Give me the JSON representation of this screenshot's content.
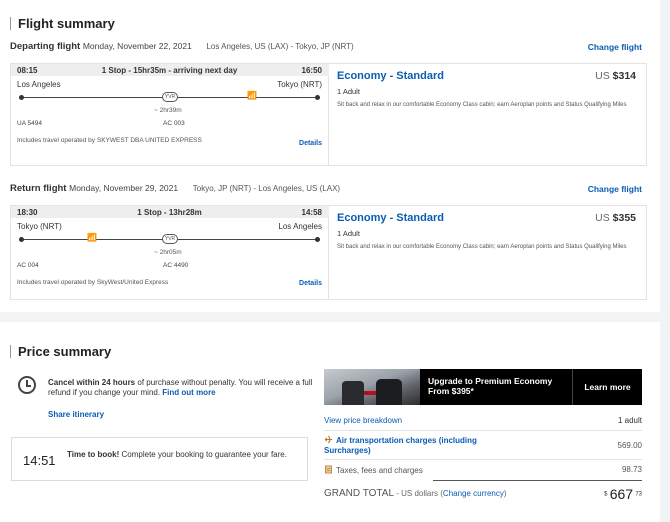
{
  "flight_summary": {
    "title": "Flight summary"
  },
  "departing": {
    "label": "Departing flight",
    "date": "Monday, November 22, 2021",
    "route": "Los Angeles, US (LAX) - Tokyo, JP (NRT)",
    "change": "Change flight",
    "depart_time": "08:15",
    "summary": "1 Stop - 15hr35m - arriving next day",
    "arrive_time": "16:50",
    "origin": "Los Angeles",
    "destination": "Tokyo (NRT)",
    "stop_code": "YVR",
    "layover": "~ 2hr39m",
    "flight1": "UA 5494",
    "flight2": "AC 003",
    "operated": "Includes travel operated by SKYWEST DBA UNITED EXPRESS",
    "details": "Details",
    "cabin": "Economy - Standard",
    "currency": "US",
    "price": "$314",
    "pax": "1 Adult",
    "desc": "Sit back and relax in our comfortable Economy Class cabin; earn Aeroplan points and Status Qualifying Miles"
  },
  "return": {
    "label": "Return flight",
    "date": "Monday, November 29, 2021",
    "route": "Tokyo, JP (NRT) - Los Angeles, US (LAX)",
    "change": "Change flight",
    "depart_time": "18:30",
    "summary": "1 Stop - 13hr28m",
    "arrive_time": "14:58",
    "origin": "Tokyo (NRT)",
    "destination": "Los Angeles",
    "stop_code": "YVR",
    "layover": "~ 2hr05m",
    "flight1": "AC 004",
    "flight2": "AC 4490",
    "operated": "Includes travel operated by SkyWest/United Express",
    "details": "Details",
    "cabin": "Economy - Standard",
    "currency": "US",
    "price": "$355",
    "pax": "1 Adult",
    "desc": "Sit back and relax in our comfortable Economy Class cabin; earn Aeroplan points and Status Qualifying Miles"
  },
  "price_summary": {
    "title": "Price summary",
    "cancel_bold": "Cancel within 24 hours",
    "cancel_text": " of purchase without penalty. You will receive a full refund if you change your mind. ",
    "find_out": "Find out more",
    "share": "Share itinerary",
    "timer": "14:51",
    "timer_bold": "Time to book!",
    "timer_text": " Complete your booking to guarantee your fare.",
    "promo_line1": "Upgrade to Premium Economy",
    "promo_line2": "From $395*",
    "learn_more": "Learn more",
    "view_breakdown": "View price breakdown",
    "pax": "1 adult",
    "air_label": "Air transportation charges (including Surcharges)",
    "air_value": "569.00",
    "taxes_label": "Taxes, fees and charges",
    "taxes_value": "98.73",
    "grand_label": "GRAND TOTAL",
    "grand_currency": " - US dollars (",
    "change_currency": "Change currency",
    "grand_close": ")",
    "total_symbol": "$",
    "total_int": "667",
    "total_dec": "73"
  }
}
